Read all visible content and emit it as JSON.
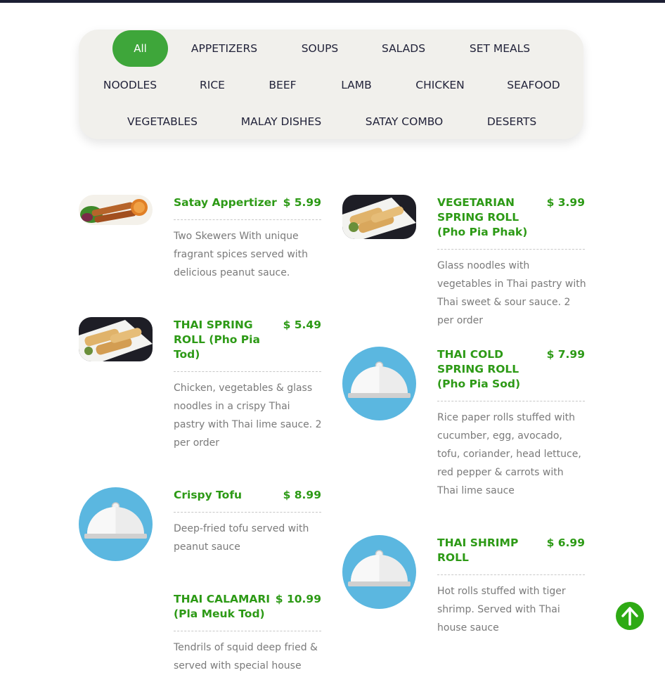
{
  "categories": [
    {
      "label": "All",
      "active": true
    },
    {
      "label": "APPETIZERS"
    },
    {
      "label": "SOUPS"
    },
    {
      "label": "SALADS"
    },
    {
      "label": "SET MEALS"
    },
    {
      "label": "NOODLES"
    },
    {
      "label": "RICE"
    },
    {
      "label": "BEEF"
    },
    {
      "label": "LAMB"
    },
    {
      "label": "CHICKEN"
    },
    {
      "label": "SEAFOOD"
    },
    {
      "label": "VEGETABLES"
    },
    {
      "label": "MALAY DISHES"
    },
    {
      "label": "SATAY COMBO"
    },
    {
      "label": "DESERTS"
    }
  ],
  "menu": {
    "items": [
      {
        "title": "Satay Appertizer",
        "price": "$ 5.99",
        "description": "Two Skewers With unique fragrant spices served with delicious peanut sauce.",
        "image": "satay-photo"
      },
      {
        "title": "VEGETARIAN SPRING ROLL (Pho Pia Phak)",
        "price": "$ 3.99",
        "description": "Glass noodles with vegetables in Thai pastry with Thai sweet & sour sauce. 2 per order",
        "image": "spring-roll-photo"
      },
      {
        "title": "THAI SPRING ROLL (Pho Pia Tod)",
        "price": "$ 5.49",
        "description": "Chicken, vegetables & glass noodles in a crispy Thai pastry with Thai lime sauce. 2 per order",
        "image": "spring-roll-photo"
      },
      {
        "title": "THAI COLD SPRING ROLL (Pho Pia Sod)",
        "price": "$ 7.99",
        "description": "Rice paper rolls stuffed with cucumber, egg, avocado, tofu, coriander, head lettuce, red pepper & carrots with Thai lime sauce",
        "image": "cloche-icon"
      },
      {
        "title": "Crispy Tofu",
        "price": "$ 8.99",
        "description": "Deep-fried tofu served with peanut sauce",
        "image": "cloche-icon"
      },
      {
        "title": "THAI SHRIMP ROLL",
        "price": "$ 6.99",
        "description": "Hot rolls stuffed with tiger shrimp. Served with Thai house sauce",
        "image": "cloche-icon"
      },
      {
        "title": "THAI CALAMARI (Pla Meuk Tod)",
        "price": "$ 10.99",
        "description": "Tendrils of squid deep fried & served with special house",
        "image": "none"
      }
    ]
  },
  "scroll_top": {
    "icon": "arrow-up-icon",
    "color": "#2eaa14"
  },
  "colors": {
    "accent": "#3ea63a",
    "item_title": "#2d9a16",
    "placeholder_bg": "#5bb7e0"
  }
}
